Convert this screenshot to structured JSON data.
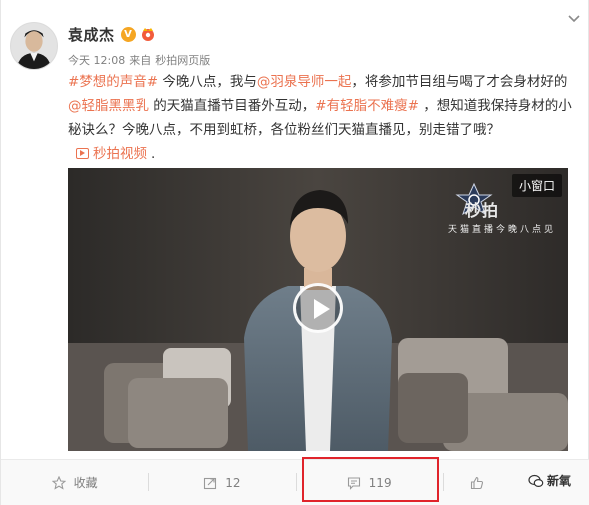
{
  "author": {
    "name": "袁成杰",
    "verified_badge": "V"
  },
  "meta": {
    "time": "今天 12:08",
    "source_prefix": "来自",
    "source": "秒拍网页版"
  },
  "post": {
    "segments": [
      {
        "type": "tag",
        "text": "#梦想的声音#"
      },
      {
        "type": "text",
        "text": " 今晚八点，我与"
      },
      {
        "type": "mention",
        "text": "@羽泉导师一起"
      },
      {
        "type": "text",
        "text": "，将参加节目组与喝了才会身材好的 "
      },
      {
        "type": "mention",
        "text": "@轻脂黑黑乳"
      },
      {
        "type": "text",
        "text": " 的天猫直播节目番外互动，"
      },
      {
        "type": "tag",
        "text": "#有轻脂不难瘦#"
      },
      {
        "type": "text",
        "text": " ，想知道我保持身材的小秘诀么？今晚八点，不用到虹桥，各位粉丝们天猫直播见，别走错了哦？"
      }
    ],
    "video_link": "秒拍视频",
    "video_link_suffix": "."
  },
  "video": {
    "mini_window_label": "小窗口",
    "watermark": "秒拍",
    "watermark_sub": "天猫直播今晚八点见"
  },
  "actions": {
    "favorite": "收藏",
    "repost": "12",
    "comment": "119",
    "like": ""
  },
  "watermark_brand": "新氧",
  "colors": {
    "link": "#eb7350",
    "highlight": "#e0242b",
    "verified": "#f5a623"
  }
}
